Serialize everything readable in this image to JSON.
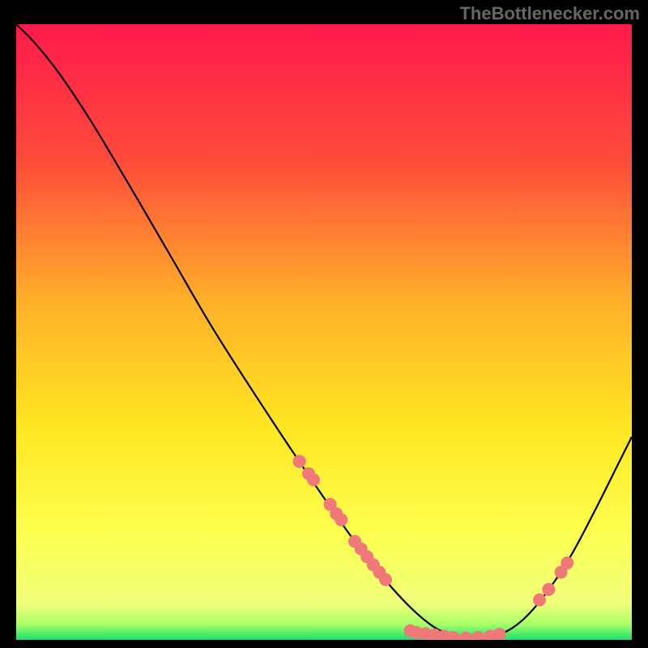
{
  "watermark": "TheBottlenecker.com",
  "chart_data": {
    "type": "line",
    "title": "",
    "xlabel": "",
    "ylabel": "",
    "xlim": [
      0,
      100
    ],
    "ylim": [
      0,
      100
    ],
    "gradient_stops": [
      {
        "offset": 0,
        "color": "#ff1a4c"
      },
      {
        "offset": 22,
        "color": "#ff4b3a"
      },
      {
        "offset": 45,
        "color": "#ffb029"
      },
      {
        "offset": 65,
        "color": "#ffe521"
      },
      {
        "offset": 82,
        "color": "#fdff4d"
      },
      {
        "offset": 94,
        "color": "#f0ff7a"
      },
      {
        "offset": 97.5,
        "color": "#a8ff6a"
      },
      {
        "offset": 100,
        "color": "#14e26a"
      }
    ],
    "curve": [
      {
        "x": 0.0,
        "y": 100.0
      },
      {
        "x": 3.0,
        "y": 97.0
      },
      {
        "x": 7.0,
        "y": 92.0
      },
      {
        "x": 12.0,
        "y": 84.5
      },
      {
        "x": 18.0,
        "y": 74.5
      },
      {
        "x": 25.0,
        "y": 62.5
      },
      {
        "x": 32.0,
        "y": 50.5
      },
      {
        "x": 40.0,
        "y": 38.0
      },
      {
        "x": 48.0,
        "y": 26.0
      },
      {
        "x": 55.0,
        "y": 16.0
      },
      {
        "x": 61.0,
        "y": 8.5
      },
      {
        "x": 66.0,
        "y": 3.5
      },
      {
        "x": 70.0,
        "y": 1.0
      },
      {
        "x": 74.0,
        "y": 0.2
      },
      {
        "x": 78.0,
        "y": 0.7
      },
      {
        "x": 82.0,
        "y": 3.0
      },
      {
        "x": 86.0,
        "y": 7.5
      },
      {
        "x": 90.0,
        "y": 13.5
      },
      {
        "x": 94.0,
        "y": 21.0
      },
      {
        "x": 98.0,
        "y": 29.0
      },
      {
        "x": 100.0,
        "y": 33.0
      }
    ],
    "scatter": [
      {
        "x": 46.0,
        "y": 29.0
      },
      {
        "x": 47.5,
        "y": 27.0
      },
      {
        "x": 48.3,
        "y": 26.0
      },
      {
        "x": 51.0,
        "y": 22.0
      },
      {
        "x": 52.0,
        "y": 20.5
      },
      {
        "x": 52.8,
        "y": 19.5
      },
      {
        "x": 55.0,
        "y": 16.0
      },
      {
        "x": 56.0,
        "y": 14.8
      },
      {
        "x": 57.0,
        "y": 13.5
      },
      {
        "x": 58.0,
        "y": 12.2
      },
      {
        "x": 59.0,
        "y": 11.0
      },
      {
        "x": 60.0,
        "y": 9.8
      },
      {
        "x": 64.0,
        "y": 1.5
      },
      {
        "x": 65.0,
        "y": 1.2
      },
      {
        "x": 66.5,
        "y": 1.0
      },
      {
        "x": 68.0,
        "y": 0.8
      },
      {
        "x": 69.5,
        "y": 0.6
      },
      {
        "x": 71.0,
        "y": 0.4
      },
      {
        "x": 73.0,
        "y": 0.3
      },
      {
        "x": 75.0,
        "y": 0.4
      },
      {
        "x": 77.0,
        "y": 0.6
      },
      {
        "x": 78.5,
        "y": 0.9
      },
      {
        "x": 85.0,
        "y": 6.5
      },
      {
        "x": 86.5,
        "y": 8.2
      },
      {
        "x": 88.5,
        "y": 11.0
      },
      {
        "x": 89.5,
        "y": 12.5
      }
    ],
    "scatter_color": "#f07878",
    "scatter_radius": 8
  }
}
